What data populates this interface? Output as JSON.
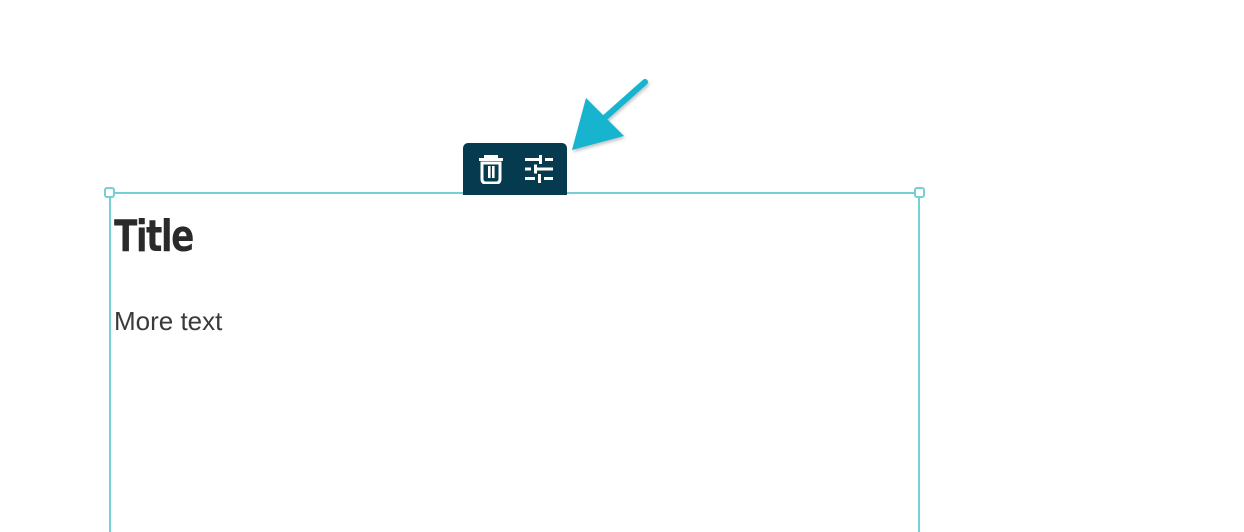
{
  "editor": {
    "block": {
      "title": "Title",
      "body_text": "More text"
    },
    "toolbar": {
      "delete_icon": "trash-icon",
      "settings_icon": "sliders-icon"
    }
  },
  "colors": {
    "selection_border": "#76cfd4",
    "toolbar_bg": "#063a4f",
    "arrow": "#19b4cf",
    "title_text": "#2a2a2a",
    "body_text": "#3a3a3a"
  },
  "annotation": {
    "arrow_icon": "pointer-arrow-icon"
  }
}
